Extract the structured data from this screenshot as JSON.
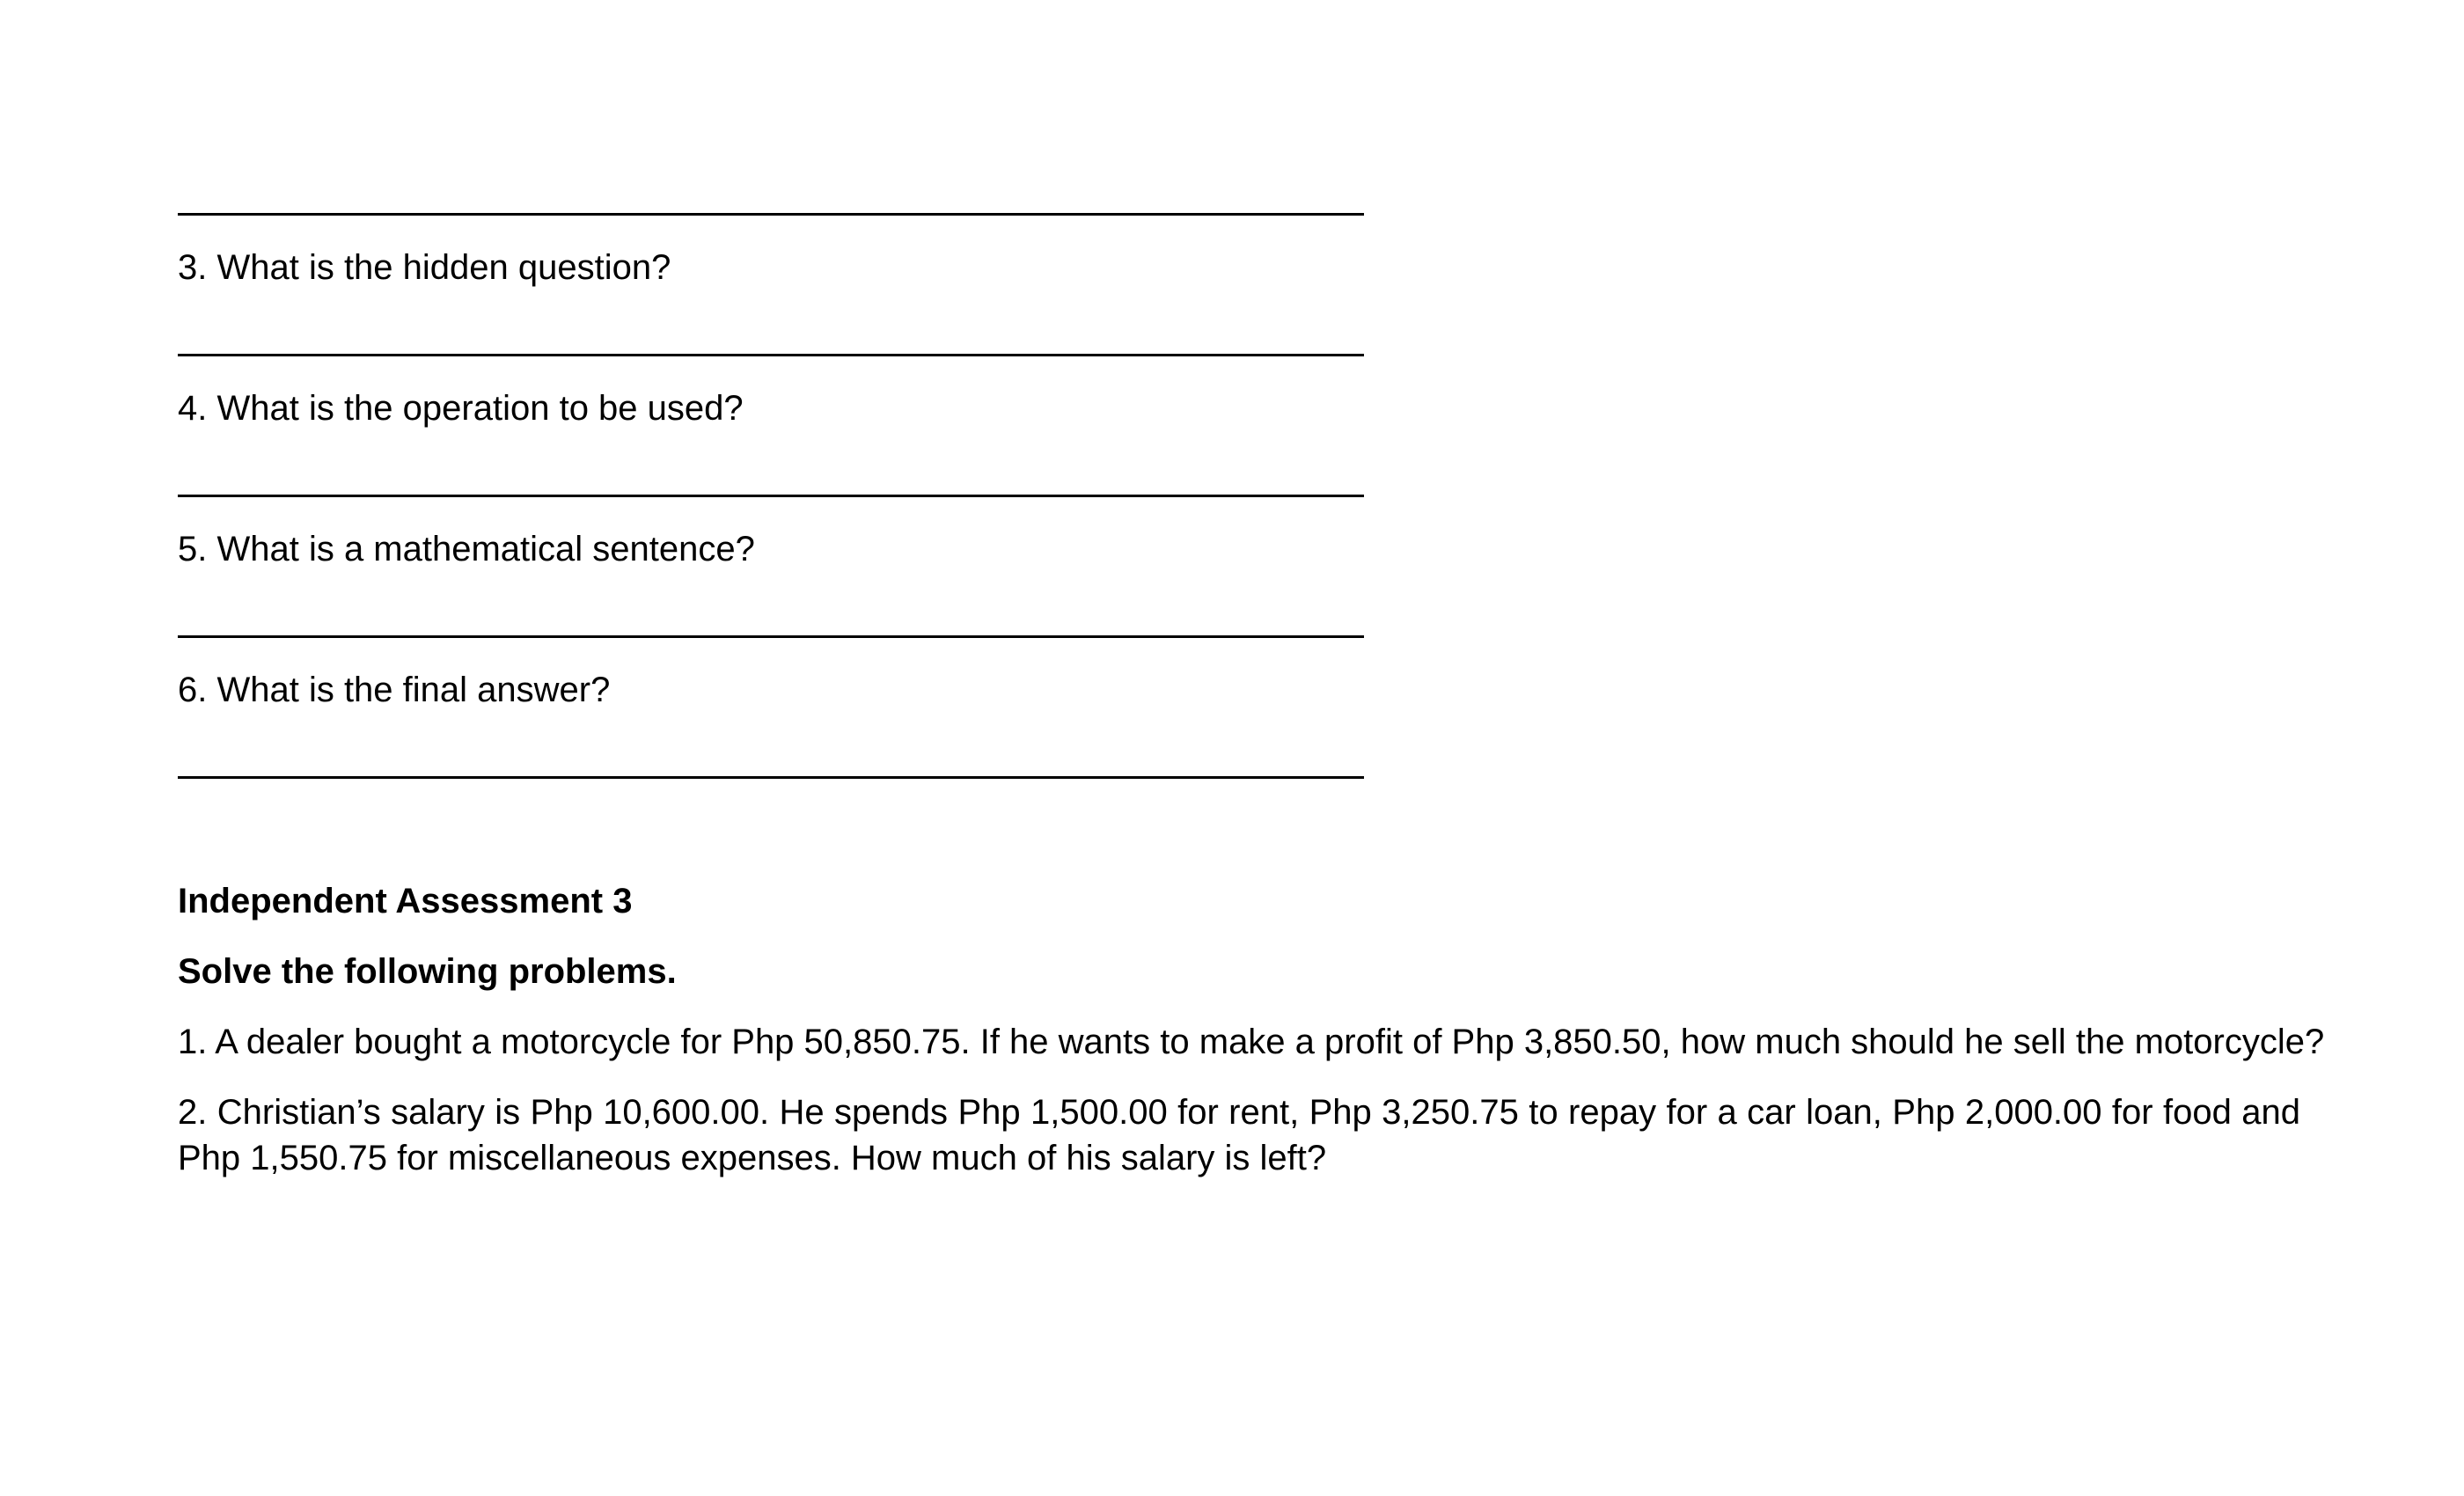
{
  "questions": [
    {
      "text": "3. What is the hidden question?"
    },
    {
      "text": "4. What is the operation to be used?"
    },
    {
      "text": "5. What is a mathematical sentence?"
    },
    {
      "text": "6. What is the final answer?"
    }
  ],
  "assessment": {
    "title": "Independent Assessment 3",
    "instruction": "Solve the following problems.",
    "problems": [
      {
        "text": "1. A dealer bought a motorcycle for Php 50,850.75. If he wants to make a profit of Php 3,850.50, how much should he sell the motorcycle?"
      },
      {
        "text": "2. Christian’s salary is Php 10,600.00. He spends Php 1,500.00 for rent, Php 3,250.75 to repay for a car loan, Php 2,000.00 for food and Php 1,550.75 for miscellaneous expenses. How much of his salary is left?"
      }
    ]
  }
}
